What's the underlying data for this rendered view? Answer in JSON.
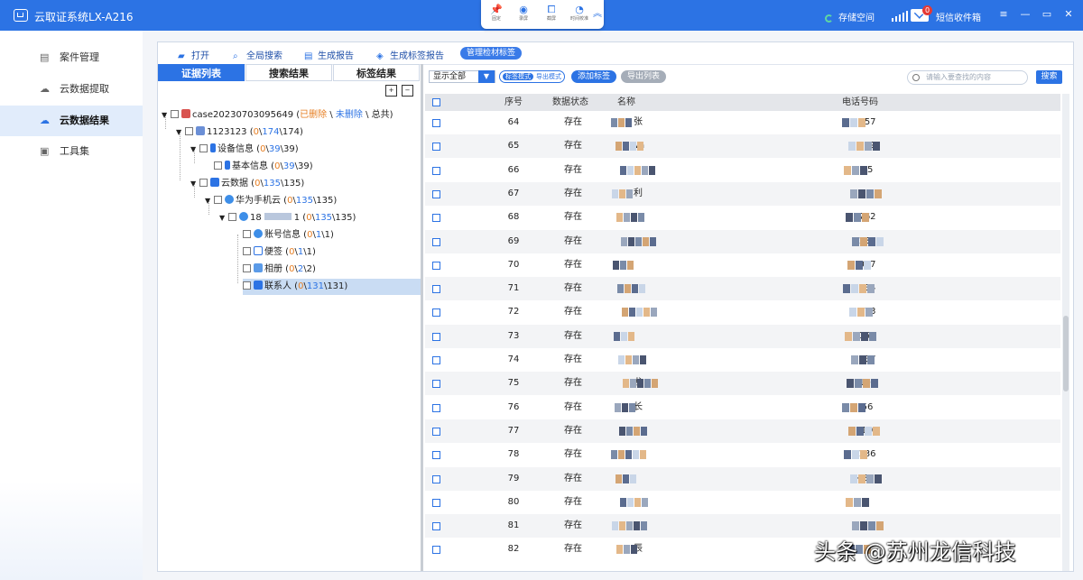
{
  "app": {
    "title": "云取证系统LX-A216"
  },
  "toolbox": {
    "items": [
      {
        "icon": "pin-icon",
        "label": "固定"
      },
      {
        "icon": "record-icon",
        "label": "录屏"
      },
      {
        "icon": "crop-icon",
        "label": "截屏"
      },
      {
        "icon": "time-icon",
        "label": "时间校准"
      }
    ]
  },
  "titlebar": {
    "storage_label": "存储空间",
    "sms_label": "短信收件箱",
    "sms_badge": "0",
    "ctl": {
      "menu": "≡",
      "min": "—",
      "max": "▭",
      "close": "✕"
    }
  },
  "sidebar": {
    "items": [
      {
        "label": "案件管理",
        "icon": "document-icon",
        "glyph": "▤"
      },
      {
        "label": "云数据提取",
        "icon": "cloud-upload-icon",
        "glyph": "☁"
      },
      {
        "label": "云数据结果",
        "icon": "cloud-icon",
        "glyph": "☁"
      },
      {
        "label": "工具集",
        "icon": "toolbox-icon",
        "glyph": "▣"
      }
    ],
    "active": 2
  },
  "toolbar": {
    "open": "打开",
    "global_search": "全局搜索",
    "generate_report": "生成报告",
    "generate_tag_report": "生成标签报告",
    "manage_tags": "管理检材标签"
  },
  "left_tabs": [
    "证据列表",
    "搜索结果",
    "标签结果"
  ],
  "tree": {
    "case": {
      "name": "case20230703095649 (",
      "deleted": "已删除",
      "sep1": "\\",
      "undeleted": "未删除",
      "rest": "\\ 总共)"
    },
    "nodes": [
      {
        "name": "1123123",
        "a": "0",
        "b": "174",
        "c": "174"
      },
      {
        "name": "设备信息",
        "a": "0",
        "b": "39",
        "c": "39"
      },
      {
        "name": "基本信息",
        "a": "0",
        "b": "39",
        "c": "39"
      },
      {
        "name": "云数据",
        "a": "0",
        "b": "135",
        "c": "135"
      },
      {
        "name": "华为手机云",
        "a": "0",
        "b": "135",
        "c": "135"
      },
      {
        "name": "18",
        "a": "0",
        "b": "135",
        "c": "135",
        "mid": "1"
      },
      {
        "name": "账号信息",
        "a": "0",
        "b": "1",
        "c": "1"
      },
      {
        "name": "便签",
        "a": "0",
        "b": "1",
        "c": "1"
      },
      {
        "name": "相册",
        "a": "0",
        "b": "2",
        "c": "2"
      },
      {
        "name": "联系人",
        "a": "0",
        "b": "131",
        "c": "131"
      }
    ]
  },
  "right_bar": {
    "select_value": "显示全部",
    "mode_on": "标签模式",
    "mode_off": "导出模式",
    "add_tag": "添加标签",
    "export_list": "导出列表",
    "search_placeholder": "请输入要查找的内容",
    "search_btn": "搜索"
  },
  "grid": {
    "headers": {
      "index": "序号",
      "status": "数据状态",
      "name": "名称",
      "phone": "电话号码"
    },
    "rows": [
      {
        "index": "64",
        "status": "存在",
        "name": "张",
        "phone": "157"
      },
      {
        "index": "65",
        "status": "存在",
        "name": "wa",
        "phone": "159"
      },
      {
        "index": "66",
        "status": "存在",
        "name": "",
        "phone": "15"
      },
      {
        "index": "67",
        "status": "存在",
        "name": "利",
        "phone": ""
      },
      {
        "index": "68",
        "status": "存在",
        "name": "",
        "phone": "762"
      },
      {
        "index": "69",
        "status": "存在",
        "name": "",
        "phone": "137"
      },
      {
        "index": "70",
        "status": "存在",
        "name": "",
        "phone": "057"
      },
      {
        "index": "71",
        "status": "存在",
        "name": "",
        "phone": "134"
      },
      {
        "index": "72",
        "status": "存在",
        "name": "",
        "phone": "173"
      },
      {
        "index": "73",
        "status": "存在",
        "name": "",
        "phone": "151"
      },
      {
        "index": "74",
        "status": "存在",
        "name": "",
        "phone": "137"
      },
      {
        "index": "75",
        "status": "存在",
        "name": "龙",
        "phone": "186"
      },
      {
        "index": "76",
        "status": "存在",
        "name": "长",
        "phone": "56"
      },
      {
        "index": "77",
        "status": "存在",
        "name": "",
        "phone": "19"
      },
      {
        "index": "78",
        "status": "存在",
        "name": "",
        "phone": "136"
      },
      {
        "index": "79",
        "status": "存在",
        "name": "",
        "phone": "+861"
      },
      {
        "index": "80",
        "status": "存在",
        "name": "",
        "phone": ""
      },
      {
        "index": "81",
        "status": "存在",
        "name": "",
        "phone": ""
      },
      {
        "index": "82",
        "status": "存在",
        "name": "辰",
        "phone": ""
      }
    ]
  },
  "watermark": "头条 @苏州龙信科技"
}
